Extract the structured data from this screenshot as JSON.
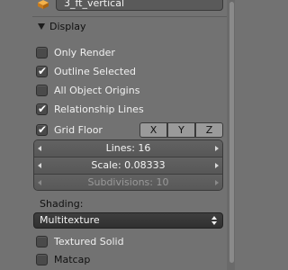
{
  "object": {
    "name": "3_ft_vertical",
    "icon": "object-cube-icon"
  },
  "display": {
    "title": "Display",
    "options": [
      {
        "label": "Only Render",
        "checked": false
      },
      {
        "label": "Outline Selected",
        "checked": true
      },
      {
        "label": "All Object Origins",
        "checked": false
      },
      {
        "label": "Relationship Lines",
        "checked": true
      }
    ],
    "grid_floor": {
      "label": "Grid Floor",
      "checked": true
    },
    "axes": [
      "X",
      "Y",
      "Z"
    ],
    "lines": "Lines: 16",
    "scale": "Scale: 0.08333",
    "subdivisions": "Subdivisions: 10"
  },
  "shading": {
    "label": "Shading:",
    "selected": "Multitexture",
    "options": [
      {
        "label": "Textured Solid",
        "checked": false
      },
      {
        "label": "Matcap",
        "checked": false
      }
    ]
  },
  "colors": {
    "panel": "#727272",
    "accent_icon": "#e8a23a"
  }
}
